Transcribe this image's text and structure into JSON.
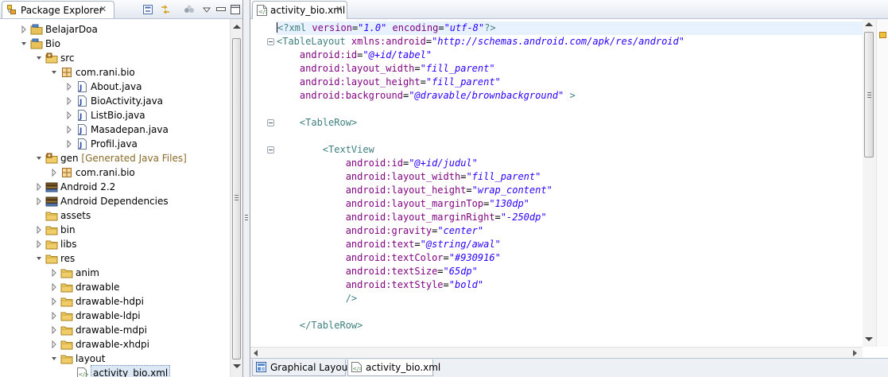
{
  "explorer": {
    "tab_title": "Package Explorer",
    "tab_close": "✕",
    "toolbar": [
      "collapse-all-icon",
      "link-with-editor-icon",
      "filters-icon",
      "view-menu-icon",
      "minimize-icon",
      "maximize-icon"
    ],
    "tree": [
      {
        "label": "BelajarDoa",
        "suffix": "",
        "indent": 0,
        "icon": "project",
        "twisty": "collapsed"
      },
      {
        "label": "Bio",
        "suffix": "",
        "indent": 0,
        "icon": "project",
        "twisty": "expanded"
      },
      {
        "label": "src",
        "suffix": "",
        "indent": 1,
        "icon": "source-folder",
        "twisty": "expanded"
      },
      {
        "label": "com.rani.bio",
        "suffix": "",
        "indent": 2,
        "icon": "package",
        "twisty": "expanded"
      },
      {
        "label": "About.java",
        "suffix": "",
        "indent": 3,
        "icon": "java-file",
        "twisty": "collapsed"
      },
      {
        "label": "BioActivity.java",
        "suffix": "",
        "indent": 3,
        "icon": "java-file",
        "twisty": "collapsed"
      },
      {
        "label": "ListBio.java",
        "suffix": "",
        "indent": 3,
        "icon": "java-file",
        "twisty": "collapsed"
      },
      {
        "label": "Masadepan.java",
        "suffix": "",
        "indent": 3,
        "icon": "java-file",
        "twisty": "collapsed"
      },
      {
        "label": "Profil.java",
        "suffix": "",
        "indent": 3,
        "icon": "java-file",
        "twisty": "collapsed"
      },
      {
        "label": "gen",
        "suffix": " [Generated Java Files]",
        "indent": 1,
        "icon": "source-folder",
        "twisty": "expanded"
      },
      {
        "label": "com.rani.bio",
        "suffix": "",
        "indent": 2,
        "icon": "package",
        "twisty": "collapsed"
      },
      {
        "label": "Android 2.2",
        "suffix": "",
        "indent": 1,
        "icon": "library",
        "twisty": "collapsed"
      },
      {
        "label": "Android Dependencies",
        "suffix": "",
        "indent": 1,
        "icon": "library",
        "twisty": "collapsed"
      },
      {
        "label": "assets",
        "suffix": "",
        "indent": 1,
        "icon": "folder",
        "twisty": "none"
      },
      {
        "label": "bin",
        "suffix": "",
        "indent": 1,
        "icon": "folder",
        "twisty": "collapsed"
      },
      {
        "label": "libs",
        "suffix": "",
        "indent": 1,
        "icon": "folder",
        "twisty": "collapsed"
      },
      {
        "label": "res",
        "suffix": "",
        "indent": 1,
        "icon": "folder",
        "twisty": "expanded"
      },
      {
        "label": "anim",
        "suffix": "",
        "indent": 2,
        "icon": "folder",
        "twisty": "collapsed"
      },
      {
        "label": "drawable",
        "suffix": "",
        "indent": 2,
        "icon": "folder",
        "twisty": "collapsed"
      },
      {
        "label": "drawable-hdpi",
        "suffix": "",
        "indent": 2,
        "icon": "folder",
        "twisty": "collapsed"
      },
      {
        "label": "drawable-ldpi",
        "suffix": "",
        "indent": 2,
        "icon": "folder",
        "twisty": "collapsed"
      },
      {
        "label": "drawable-mdpi",
        "suffix": "",
        "indent": 2,
        "icon": "folder",
        "twisty": "collapsed"
      },
      {
        "label": "drawable-xhdpi",
        "suffix": "",
        "indent": 2,
        "icon": "folder",
        "twisty": "collapsed"
      },
      {
        "label": "layout",
        "suffix": "",
        "indent": 2,
        "icon": "folder",
        "twisty": "expanded"
      },
      {
        "label": "activity_bio.xml",
        "suffix": "",
        "indent": 3,
        "icon": "xml-file",
        "twisty": "none",
        "selected": true
      }
    ]
  },
  "editor": {
    "tab_title": "activity_bio.xml",
    "tab_close": "✕",
    "lines": [
      [
        [
          "pi",
          "<?xml "
        ],
        [
          "attr",
          "version"
        ],
        [
          "eq",
          "="
        ],
        [
          "val",
          "\"1.0\""
        ],
        [
          "pi",
          " "
        ],
        [
          "attr",
          "encoding"
        ],
        [
          "eq",
          "="
        ],
        [
          "val",
          "\"utf-8\""
        ],
        [
          "pi",
          "?>"
        ]
      ],
      [
        [
          "tag",
          "<TableLayout "
        ],
        [
          "attr",
          "xmlns:android"
        ],
        [
          "eq",
          "="
        ],
        [
          "val",
          "\"http://schemas.android.com/apk/res/android\""
        ]
      ],
      [
        [
          "ws",
          "    "
        ],
        [
          "attr",
          "android:id"
        ],
        [
          "eq",
          "="
        ],
        [
          "val",
          "\"@+id/tabel\""
        ]
      ],
      [
        [
          "ws",
          "    "
        ],
        [
          "attr",
          "android:layout_width"
        ],
        [
          "eq",
          "="
        ],
        [
          "val",
          "\"fill_parent\""
        ]
      ],
      [
        [
          "ws",
          "    "
        ],
        [
          "attr",
          "android:layout_height"
        ],
        [
          "eq",
          "="
        ],
        [
          "val",
          "\"fill_parent\""
        ]
      ],
      [
        [
          "ws",
          "    "
        ],
        [
          "attr",
          "android:background"
        ],
        [
          "eq",
          "="
        ],
        [
          "val",
          "\"@dravable/brownbackground\""
        ],
        [
          "tag",
          " >"
        ]
      ],
      [],
      [
        [
          "ws",
          "    "
        ],
        [
          "tag",
          "<TableRow>"
        ]
      ],
      [],
      [
        [
          "ws",
          "        "
        ],
        [
          "tag",
          "<TextView"
        ]
      ],
      [
        [
          "ws",
          "            "
        ],
        [
          "attr",
          "android:id"
        ],
        [
          "eq",
          "="
        ],
        [
          "val",
          "\"@+id/judul\""
        ]
      ],
      [
        [
          "ws",
          "            "
        ],
        [
          "attr",
          "android:layout_width"
        ],
        [
          "eq",
          "="
        ],
        [
          "val",
          "\"fill_parent\""
        ]
      ],
      [
        [
          "ws",
          "            "
        ],
        [
          "attr",
          "android:layout_height"
        ],
        [
          "eq",
          "="
        ],
        [
          "val",
          "\"wrap_content\""
        ]
      ],
      [
        [
          "ws",
          "            "
        ],
        [
          "attr",
          "android:layout_marginTop"
        ],
        [
          "eq",
          "="
        ],
        [
          "val",
          "\"130dp\""
        ]
      ],
      [
        [
          "ws",
          "            "
        ],
        [
          "attr",
          "android:layout_marginRight"
        ],
        [
          "eq",
          "="
        ],
        [
          "val",
          "\"-250dp\""
        ]
      ],
      [
        [
          "ws",
          "            "
        ],
        [
          "attr",
          "android:gravity"
        ],
        [
          "eq",
          "="
        ],
        [
          "val",
          "\"center\""
        ]
      ],
      [
        [
          "ws",
          "            "
        ],
        [
          "attr",
          "android:text"
        ],
        [
          "eq",
          "="
        ],
        [
          "val",
          "\"@string/awal\""
        ]
      ],
      [
        [
          "ws",
          "            "
        ],
        [
          "attr",
          "android:textColor"
        ],
        [
          "eq",
          "="
        ],
        [
          "val",
          "\"#930916\""
        ]
      ],
      [
        [
          "ws",
          "            "
        ],
        [
          "attr",
          "android:textSize"
        ],
        [
          "eq",
          "="
        ],
        [
          "val",
          "\"65dp\""
        ]
      ],
      [
        [
          "ws",
          "            "
        ],
        [
          "attr",
          "android:textStyle"
        ],
        [
          "eq",
          "="
        ],
        [
          "val",
          "\"bold\""
        ]
      ],
      [
        [
          "ws",
          "            "
        ],
        [
          "tag",
          "/>"
        ]
      ],
      [],
      [
        [
          "ws",
          "    "
        ],
        [
          "tag",
          "</TableRow>"
        ]
      ]
    ],
    "fold_lines": [
      1,
      7,
      9
    ],
    "bottom_tabs": [
      {
        "label": "Graphical Layout",
        "icon": "graphical-layout-icon",
        "active": false
      },
      {
        "label": "activity_bio.xml",
        "icon": "xml-source-icon",
        "active": true
      }
    ]
  },
  "colors": {
    "xml_tag": "#3f7f7f",
    "xml_attr": "#7f007f",
    "xml_value": "#2a00ff",
    "current_line": "#e8f2fe",
    "selection": "#dde8f6"
  }
}
